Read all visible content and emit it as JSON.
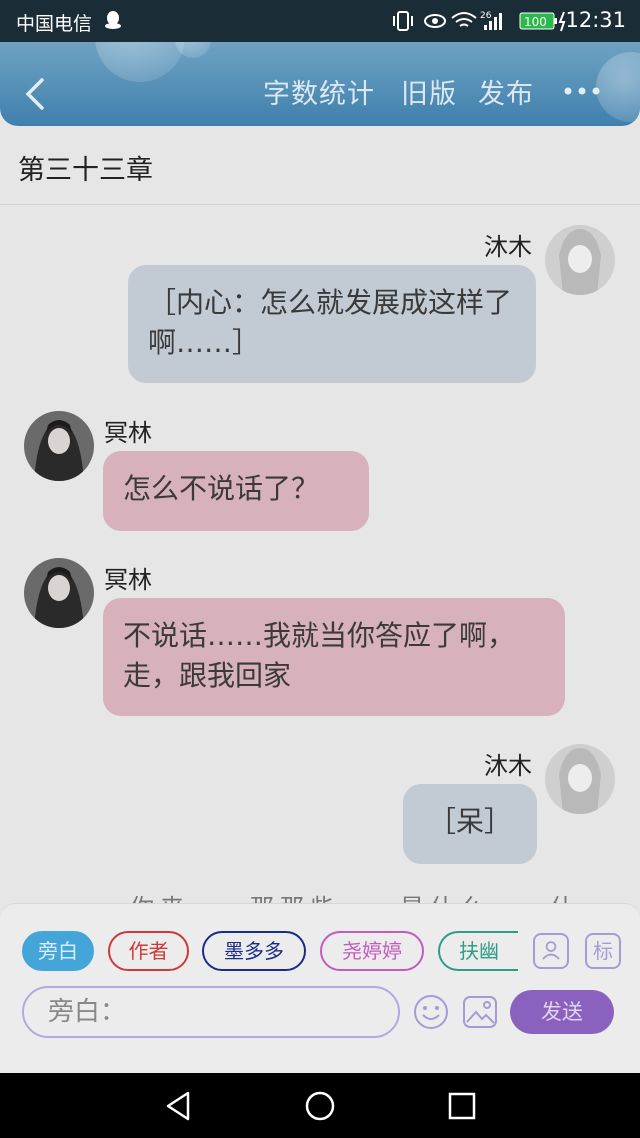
{
  "status_bar": {
    "carrier": "中国电信",
    "network_label": "26",
    "battery": "100",
    "time": "12:31"
  },
  "header": {
    "word_count": "字数统计",
    "old_version": "旧版",
    "publish": "发布"
  },
  "chapter": {
    "title": "第三十三章"
  },
  "messages": [
    {
      "sender": "沐木",
      "side": "right",
      "text": "［内心：怎么就发展成这样了啊……］"
    },
    {
      "sender": "冥林",
      "side": "left",
      "text": "怎么不说话了？"
    },
    {
      "sender": "冥林",
      "side": "left",
      "text": "不说话……我就当你答应了啊，走，跟我回家"
    },
    {
      "sender": "沐木",
      "side": "right",
      "text": "［呆］"
    }
  ],
  "peek_text": "……你来……那那些……是什么……什么……",
  "roles": [
    {
      "label": "旁白",
      "color": "#44a6d8"
    },
    {
      "label": "作者",
      "color": "#cc3a3a"
    },
    {
      "label": "墨多多",
      "color": "#1a2c86"
    },
    {
      "label": "尧婷婷",
      "color": "#c35ac0"
    },
    {
      "label": "扶幽",
      "color": "#2d9d86"
    }
  ],
  "side_label": "标",
  "input": {
    "placeholder": "旁白："
  },
  "send_label": "发送"
}
